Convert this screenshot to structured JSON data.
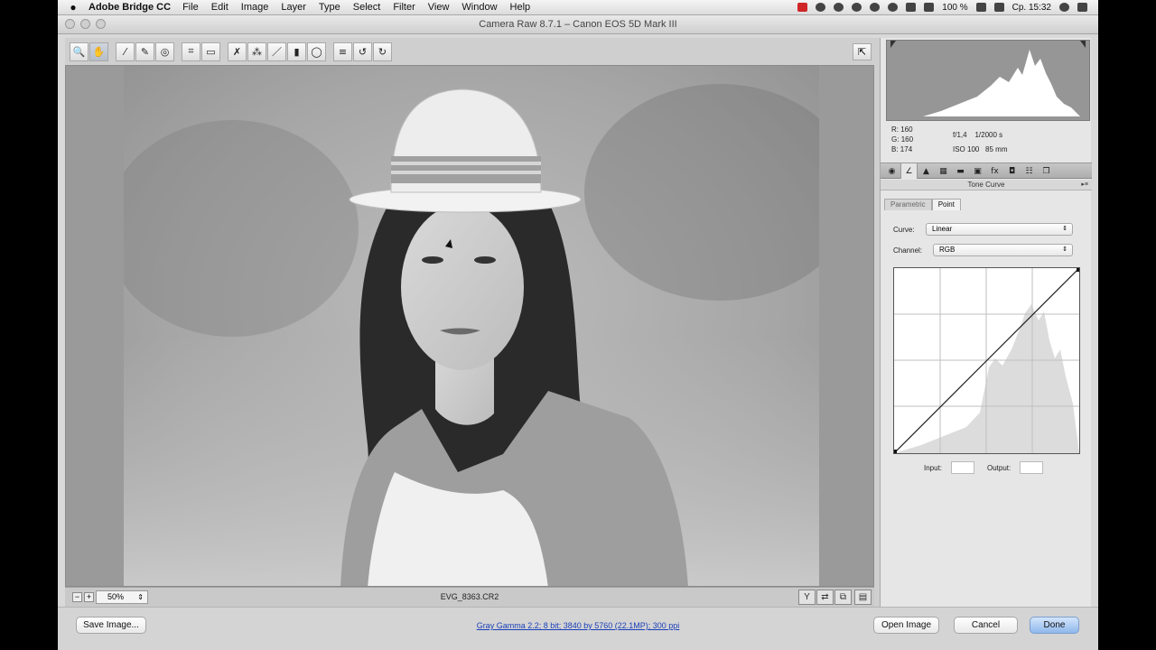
{
  "menubar": {
    "app_name": "Adobe Bridge CC",
    "menus": [
      "File",
      "Edit",
      "Image",
      "Layer",
      "Type",
      "Select",
      "Filter",
      "View",
      "Window",
      "Help"
    ],
    "battery": "100 %",
    "clock": "Ср. 15:32"
  },
  "window": {
    "title": "Camera Raw 8.7.1  –  Canon EOS 5D Mark III"
  },
  "toolbar": {
    "tools": [
      {
        "name": "zoom-tool",
        "glyph": "🔍"
      },
      {
        "name": "hand-tool",
        "glyph": "✋"
      },
      {
        "name": "white-balance-tool",
        "glyph": "⁄"
      },
      {
        "name": "color-sampler-tool",
        "glyph": "✎"
      },
      {
        "name": "targeted-adjustment-tool",
        "glyph": "◎"
      },
      {
        "name": "crop-tool",
        "glyph": "⌗"
      },
      {
        "name": "straighten-tool",
        "glyph": "▭"
      },
      {
        "name": "spot-removal-tool",
        "glyph": "✗"
      },
      {
        "name": "red-eye-tool",
        "glyph": "⁂"
      },
      {
        "name": "adjustment-brush-tool",
        "glyph": "／"
      },
      {
        "name": "graduated-filter-tool",
        "glyph": "▮"
      },
      {
        "name": "radial-filter-tool",
        "glyph": "◯"
      },
      {
        "name": "preferences-tool",
        "glyph": "≡"
      },
      {
        "name": "rotate-ccw-tool",
        "glyph": "↺"
      },
      {
        "name": "rotate-cw-tool",
        "glyph": "↻"
      }
    ],
    "active_tool": "hand-tool"
  },
  "statusbar": {
    "zoom": "50%",
    "filename": "EVG_8363.CR2"
  },
  "info": {
    "r_label": "R:",
    "r_value": "160",
    "g_label": "G:",
    "g_value": "160",
    "b_label": "B:",
    "b_value": "174",
    "aperture": "f/1,4",
    "shutter": "1/2000 s",
    "iso": "ISO 100",
    "focal": "85 mm"
  },
  "panel": {
    "section_title": "Tone Curve",
    "subtab_parametric": "Parametric",
    "subtab_point": "Point",
    "curve_label": "Curve:",
    "curve_value": "Linear",
    "channel_label": "Channel:",
    "channel_value": "RGB",
    "input_label": "Input:",
    "output_label": "Output:"
  },
  "bottombar": {
    "save_label": "Save Image...",
    "workflow_link": "Gray Gamma 2.2; 8 bit; 3840 by 5760 (22.1MP); 300 ppi",
    "open_label": "Open Image",
    "cancel_label": "Cancel",
    "done_label": "Done"
  }
}
